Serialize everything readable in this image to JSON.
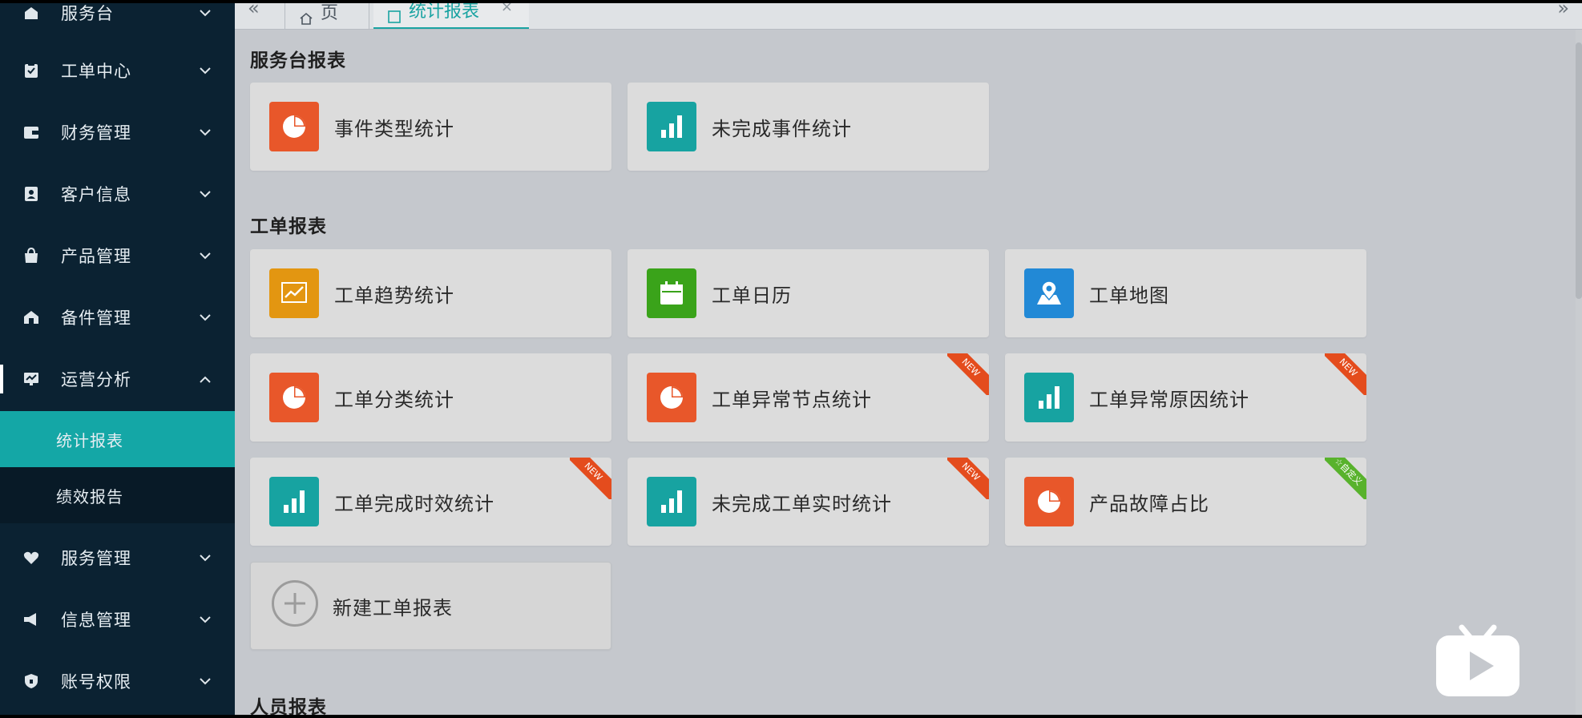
{
  "sidebar": {
    "items": [
      {
        "label": "服务台",
        "icon": "service-desk-icon"
      },
      {
        "label": "工单中心",
        "icon": "clipboard-icon"
      },
      {
        "label": "财务管理",
        "icon": "wallet-icon"
      },
      {
        "label": "客户信息",
        "icon": "contact-card-icon"
      },
      {
        "label": "产品管理",
        "icon": "bag-icon"
      },
      {
        "label": "备件管理",
        "icon": "warehouse-icon"
      },
      {
        "label": "运营分析",
        "icon": "monitor-chart-icon"
      },
      {
        "label": "服务管理",
        "icon": "heart-hands-icon"
      },
      {
        "label": "信息管理",
        "icon": "megaphone-icon"
      },
      {
        "label": "账号权限",
        "icon": "shield-icon"
      }
    ],
    "sub_items": [
      {
        "label": "统计报表"
      },
      {
        "label": "绩效报告"
      }
    ]
  },
  "tabs": [
    {
      "label": "首页",
      "icon": "home-icon"
    },
    {
      "label": "统计报表",
      "icon": "report-icon",
      "close": "×"
    }
  ],
  "sections": [
    {
      "title": "服务台报表",
      "cards": [
        {
          "title": "事件类型统计",
          "icon": "pie-chart-icon",
          "color": "#e8572a"
        },
        {
          "title": "未完成事件统计",
          "icon": "bar-chart-icon",
          "color": "#17a3a1"
        }
      ]
    },
    {
      "title": "工单报表",
      "cards": [
        {
          "title": "工单趋势统计",
          "icon": "trend-chart-icon",
          "color": "#e39611"
        },
        {
          "title": "工单日历",
          "icon": "calendar-icon",
          "color": "#3aa31a"
        },
        {
          "title": "工单地图",
          "icon": "map-pin-icon",
          "color": "#2289d6"
        },
        {
          "title": "工单分类统计",
          "icon": "pie-chart-icon",
          "color": "#e8572a"
        },
        {
          "title": "工单异常节点统计",
          "icon": "pie-chart-icon",
          "color": "#e8572a",
          "badge": "NEW"
        },
        {
          "title": "工单异常原因统计",
          "icon": "bar-chart-icon",
          "color": "#17a3a1",
          "badge": "NEW"
        },
        {
          "title": "工单完成时效统计",
          "icon": "bar-chart-icon",
          "color": "#17a3a1",
          "badge": "NEW"
        },
        {
          "title": "未完成工单实时统计",
          "icon": "bar-chart-icon",
          "color": "#17a3a1",
          "badge": "NEW"
        },
        {
          "title": "产品故障占比",
          "icon": "pie-chart-icon",
          "color": "#e8572a",
          "badge": "☆自定义"
        }
      ],
      "add_card": {
        "title": "新建工单报表",
        "icon": "plus-circle-icon"
      }
    },
    {
      "title": "人员报表"
    }
  ],
  "colors": {
    "sidebar_bg": "#0b2232",
    "accent": "#14a7a6",
    "badge_new": "#e44c1d",
    "badge_custom": "#58b22c"
  },
  "watermark": {
    "icon": "bilibili-tv-icon"
  }
}
